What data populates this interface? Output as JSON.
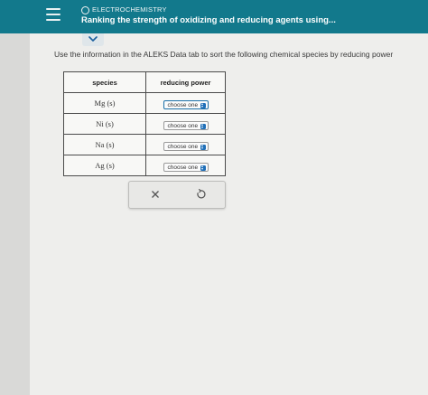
{
  "header": {
    "topic": "ELECTROCHEMISTRY",
    "title": "Ranking the strength of oxidizing and reducing agents using..."
  },
  "instruction": "Use the information in the ALEKS Data tab to sort the following chemical species by reducing power",
  "table": {
    "headers": [
      "species",
      "reducing power"
    ],
    "rows": [
      {
        "species": "Mg (s)",
        "select_value": "choose one"
      },
      {
        "species": "Ni (s)",
        "select_value": "choose one"
      },
      {
        "species": "Na (s)",
        "select_value": "choose one"
      },
      {
        "species": "Ag (s)",
        "select_value": "choose one"
      }
    ]
  },
  "icons": {
    "menu": "hamburger-icon",
    "topic": "circle-icon",
    "expand": "chevron-down-icon",
    "clear": "close-icon",
    "undo": "undo-icon",
    "select": "select-arrows-icon"
  },
  "colors": {
    "header_bg": "#12798c",
    "accent": "#1f6fb8"
  }
}
